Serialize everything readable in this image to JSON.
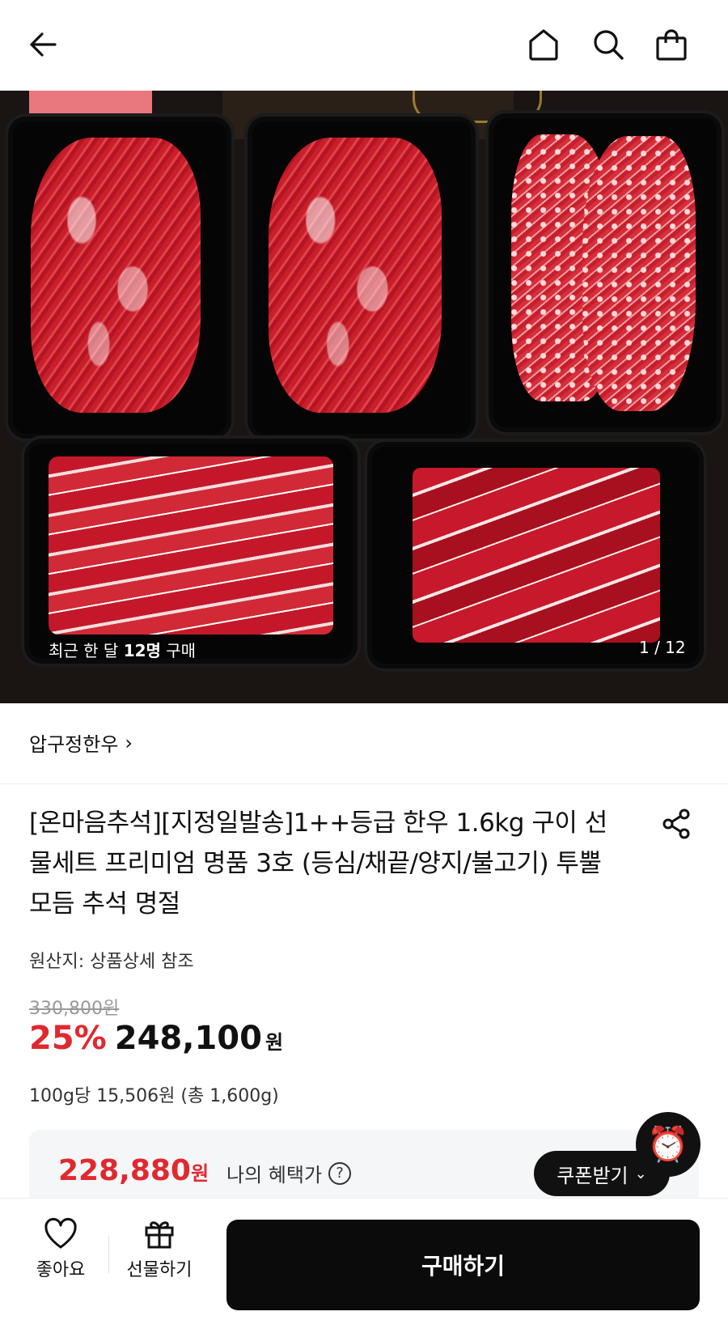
{
  "header": {
    "back_icon": "arrow-left-icon",
    "home_icon": "home-icon",
    "search_icon": "search-icon",
    "cart_icon": "shopping-bag-icon"
  },
  "hero": {
    "caption_prefix": "최근 한 달 ",
    "caption_count": "12명",
    "caption_suffix": " 구매",
    "pager": "1 / 12"
  },
  "brand": {
    "name": "압구정한우",
    "chevron": "›"
  },
  "product": {
    "title": "[온마음추석][지정일발송]1++등급 한우 1.6kg 구이 선물세트 프리미엄 명품 3호 (등심/채끝/양지/불고기) 투뿔 모듬 추석 명절",
    "origin": "원산지: 상품상세 참조",
    "original_price": "330,800원",
    "discount": "25%",
    "price": "248,100",
    "price_unit": "원",
    "unit_price": "100g당 15,506원 (총 1,600g)"
  },
  "benefit": {
    "price": "228,880",
    "price_unit": "원",
    "label": "나의 혜택가",
    "help": "?",
    "coupon_label": "쿠폰받기",
    "coupon_chevron": "⌄",
    "alarm_icon": "⏰"
  },
  "bottom": {
    "like_label": "좋아요",
    "gift_label": "선물하기",
    "buy_label": "구매하기"
  },
  "colors": {
    "accent_red": "#e0292f",
    "button_black": "#0b0b0b"
  }
}
